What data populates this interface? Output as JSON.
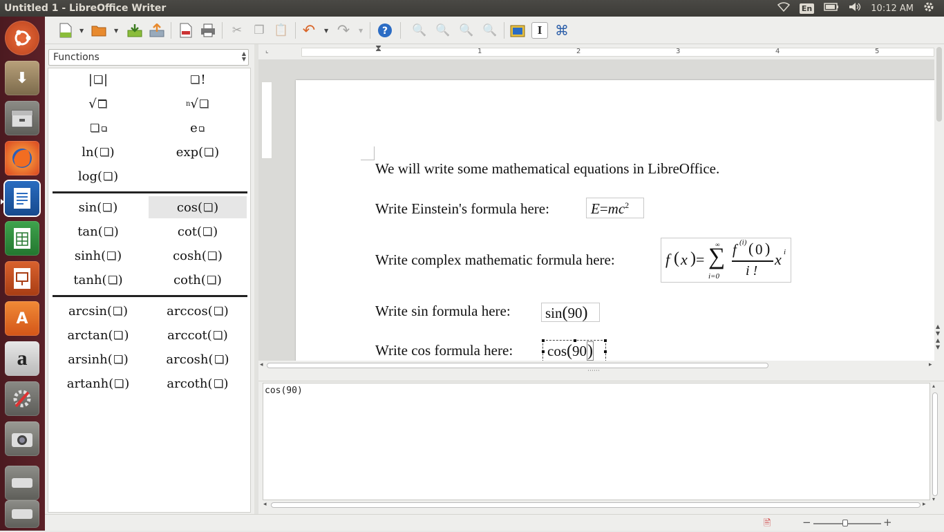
{
  "window": {
    "title": "Untitled 1 - LibreOffice Writer"
  },
  "tray": {
    "keyboard": "En",
    "time": "10:12 AM"
  },
  "sidebar": {
    "category": "Functions",
    "elements": [
      {
        "label": "|□|"
      },
      {
        "label": "□!"
      },
      {
        "label": "√□"
      },
      {
        "label": "ⁿ√□"
      },
      {
        "label": "□□"
      },
      {
        "label": "e□"
      },
      {
        "label": "ln"
      },
      {
        "label": "exp"
      },
      {
        "label": "log"
      },
      {
        "label": "sin"
      },
      {
        "label": "cos"
      },
      {
        "label": "tan"
      },
      {
        "label": "cot"
      },
      {
        "label": "sinh"
      },
      {
        "label": "cosh"
      },
      {
        "label": "tanh"
      },
      {
        "label": "coth"
      },
      {
        "label": "arcsin"
      },
      {
        "label": "arccos"
      },
      {
        "label": "arctan"
      },
      {
        "label": "arccot"
      },
      {
        "label": "arsinh"
      },
      {
        "label": "arcosh"
      },
      {
        "label": "artanh"
      },
      {
        "label": "arcoth"
      }
    ],
    "selected": "cos"
  },
  "ruler": {
    "marks": [
      "1",
      "2",
      "3",
      "4",
      "5"
    ]
  },
  "document": {
    "line1": "We will write some mathematical equations in LibreOffice.",
    "line2": "Write Einstein's formula here:",
    "line3": "Write complex mathematic formula here:",
    "line4": "Write sin formula here:",
    "line5": "Write cos formula here:",
    "formula_einstein": {
      "lhs": "E",
      "eq": "=",
      "rhs": "mc",
      "exp": "2"
    },
    "formula_complex": {
      "f": "f",
      "x": "x",
      "sum_top": "∞",
      "sum_bottom": "i=0",
      "num_f": "f",
      "num_exp": "(i)",
      "num_arg": "0",
      "den": "i !",
      "tail": "x",
      "tail_exp": "i"
    },
    "formula_sin": {
      "fn": "sin",
      "arg": "90"
    },
    "formula_cos": {
      "fn": "cos",
      "arg": "90"
    }
  },
  "command": {
    "text": "cos(90)"
  },
  "launcher": [
    "ubuntu-dash",
    "system-installer",
    "files",
    "firefox",
    "writer",
    "calc",
    "impress",
    "software-center",
    "amazon",
    "system-settings",
    "camera",
    "drive",
    "drive2"
  ]
}
